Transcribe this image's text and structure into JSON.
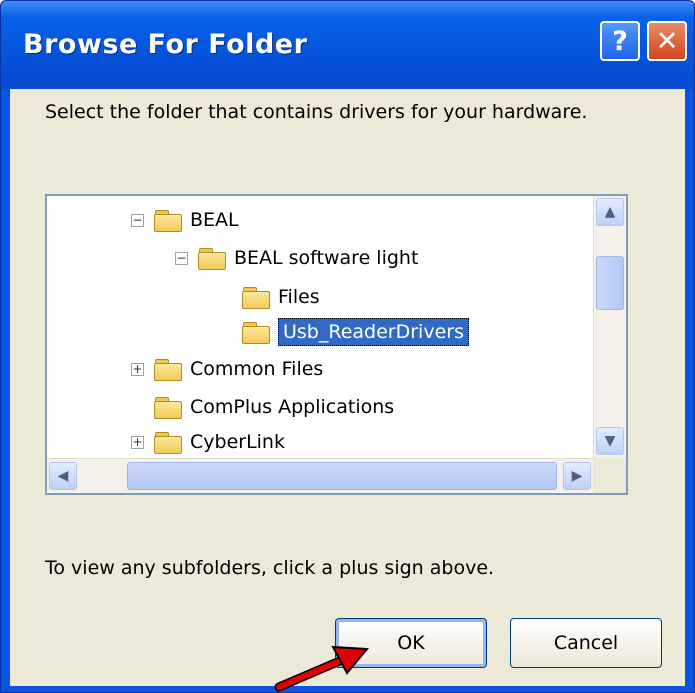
{
  "window": {
    "title": "Browse For Folder",
    "help_label": "?",
    "close_label": "✕"
  },
  "instruction": "Select the folder that contains drivers for your hardware.",
  "tree": {
    "items": [
      {
        "label": "BEAL",
        "expander": "−"
      },
      {
        "label": "BEAL software light",
        "expander": "−"
      },
      {
        "label": "Files"
      },
      {
        "label": "Usb_ReaderDrivers",
        "selected": true
      },
      {
        "label": "Common Files",
        "expander": "+"
      },
      {
        "label": "ComPlus Applications"
      },
      {
        "label": "CyberLink",
        "expander": "+"
      }
    ]
  },
  "hint": "To view any subfolders, click a plus sign above.",
  "buttons": {
    "ok": "OK",
    "cancel": "Cancel"
  },
  "scroll": {
    "up": "▲",
    "down": "▼",
    "left": "◀",
    "right": "▶"
  },
  "colors": {
    "titlebar": "#0a54e3",
    "selection": "#316ac5",
    "annotation_arrow": "#e00000"
  }
}
